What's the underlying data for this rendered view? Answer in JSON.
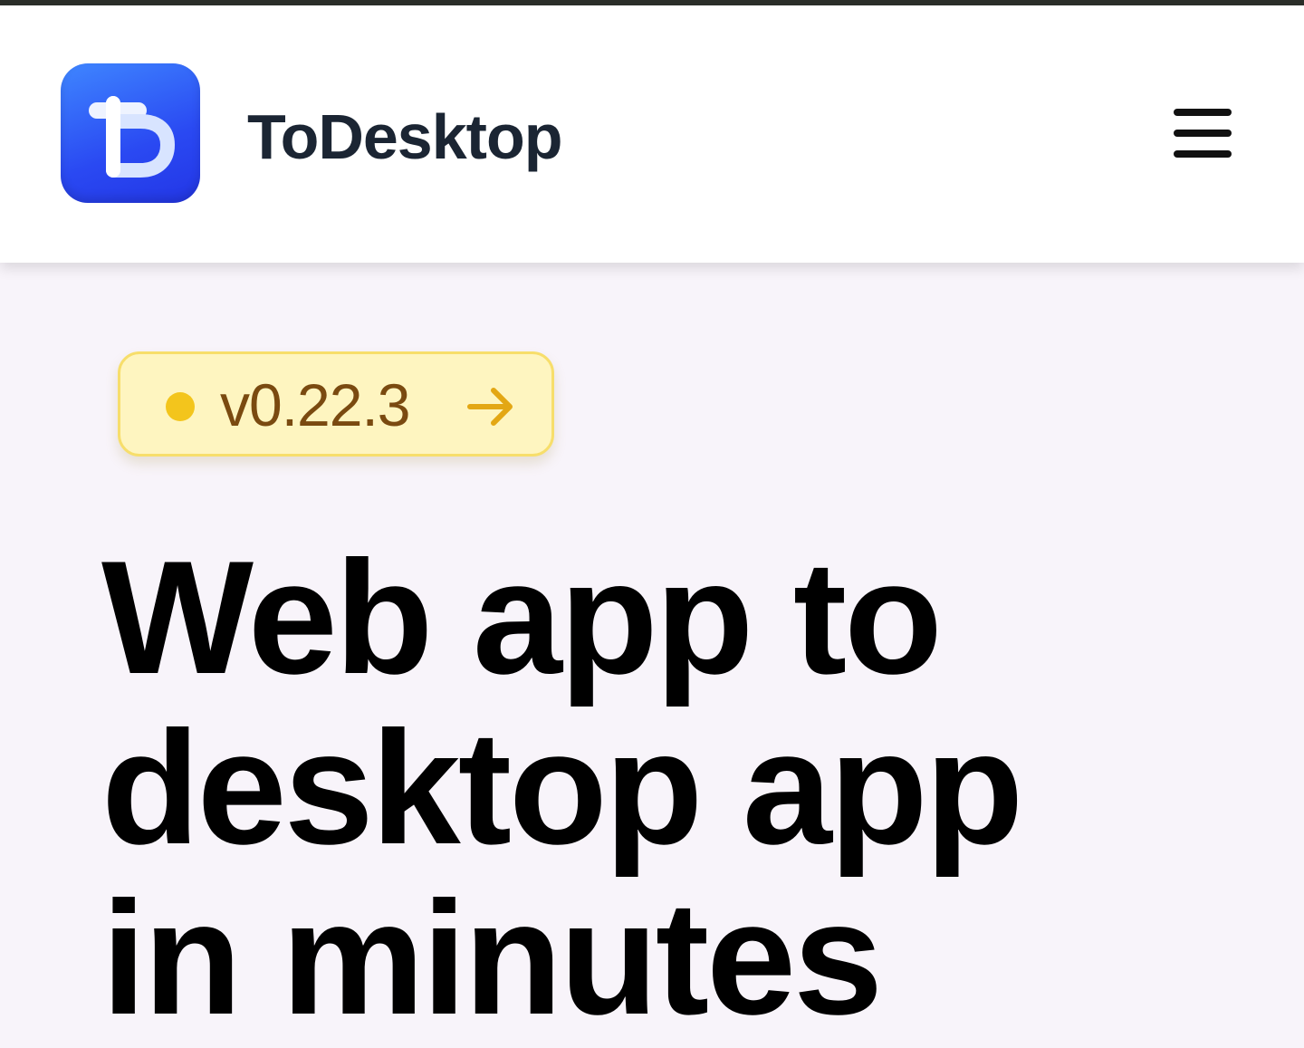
{
  "header": {
    "brand_name": "ToDesktop",
    "menu_icon": "hamburger-menu-icon"
  },
  "logo": {
    "icon": "todesktop-logo-icon",
    "colors": [
      "#3f86ff",
      "#2336e6"
    ]
  },
  "badge": {
    "version": "v0.22.3",
    "dot_color": "#f3c51c",
    "arrow_icon": "arrow-right-icon"
  },
  "hero": {
    "title_lines": [
      "Web app to",
      "desktop app",
      "in minutes"
    ]
  }
}
